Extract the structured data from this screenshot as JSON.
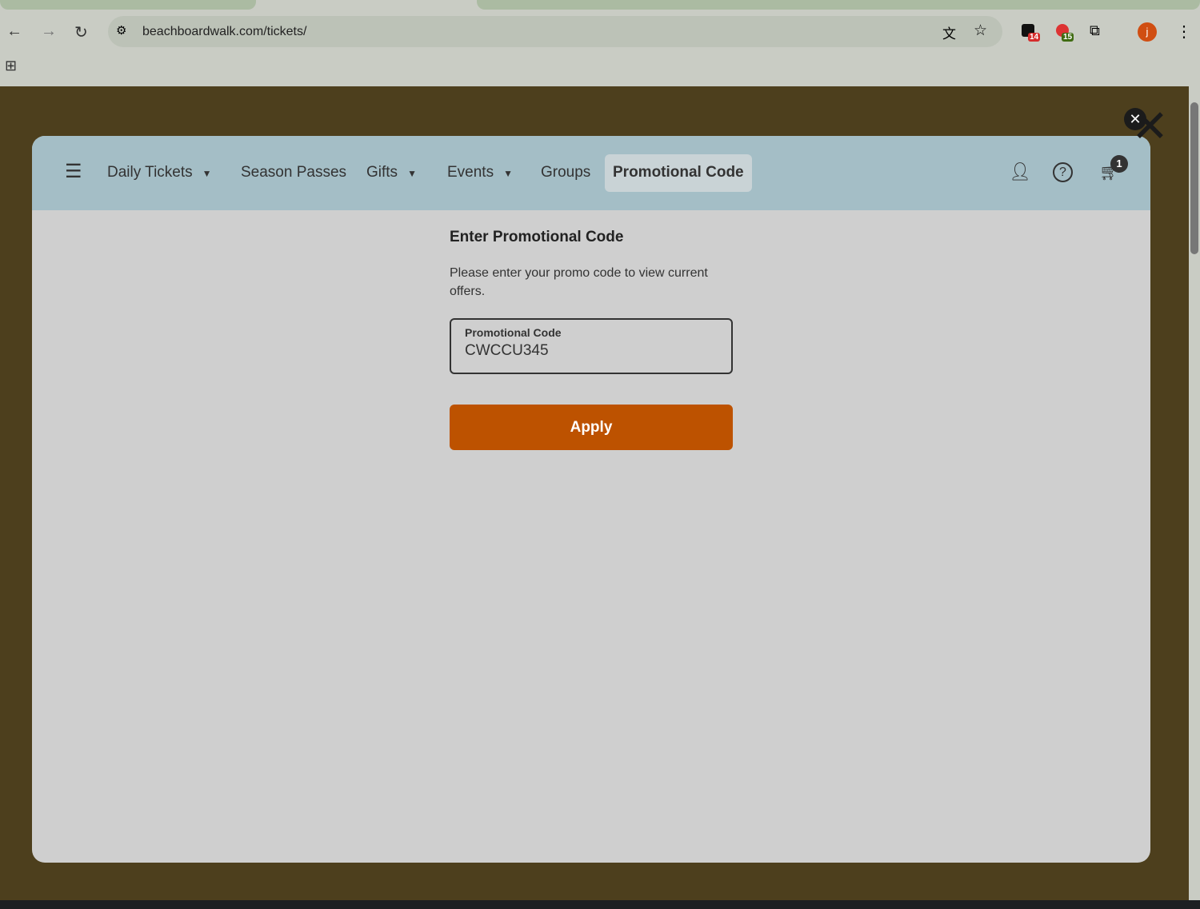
{
  "browser": {
    "url": "beachboardwalk.com/tickets/",
    "ext_badges": [
      "14",
      "15"
    ],
    "profile_initial": "j"
  },
  "nav": {
    "items": [
      {
        "label": "Daily Tickets",
        "dropdown": true
      },
      {
        "label": "Season Passes"
      },
      {
        "label": "Gifts",
        "dropdown": true
      },
      {
        "label": "Events",
        "dropdown": true
      },
      {
        "label": "Groups"
      },
      {
        "label": "Promotional Code",
        "active": true
      }
    ],
    "cart_count": "1"
  },
  "promo": {
    "title": "Enter Promotional Code",
    "description": "Please enter your promo code to view current offers.",
    "field_label": "Promotional Code",
    "field_value": "CWCCU345",
    "apply_label": "Apply"
  },
  "colors": {
    "accent": "#bd5200",
    "nav_bg": "#a4bec6",
    "overlay": "#4d3f1d"
  }
}
